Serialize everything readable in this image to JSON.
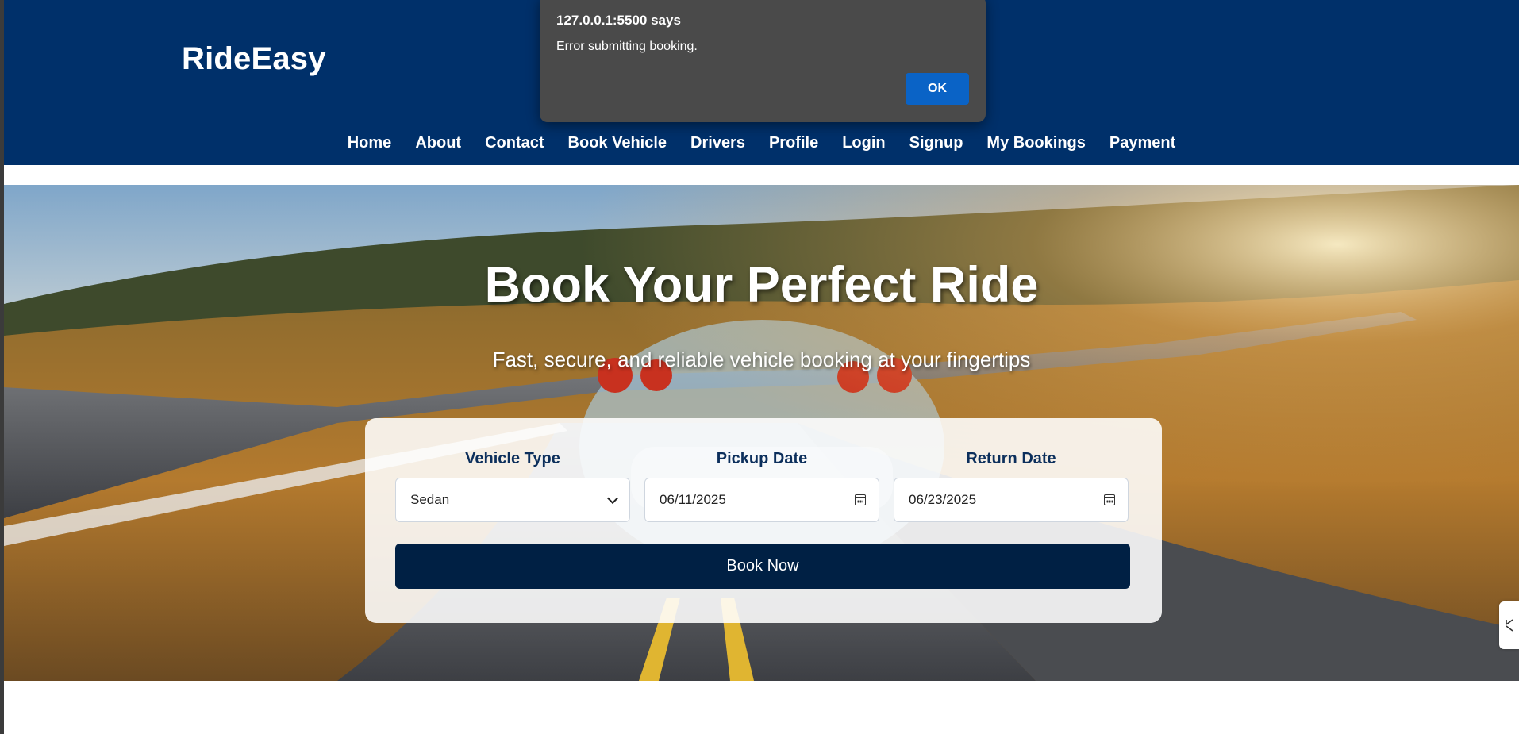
{
  "brand": {
    "name": "RideEasy"
  },
  "nav": {
    "items": [
      {
        "label": "Home"
      },
      {
        "label": "About"
      },
      {
        "label": "Contact"
      },
      {
        "label": "Book Vehicle"
      },
      {
        "label": "Drivers"
      },
      {
        "label": "Profile"
      },
      {
        "label": "Login"
      },
      {
        "label": "Signup"
      },
      {
        "label": "My Bookings"
      },
      {
        "label": "Payment"
      }
    ]
  },
  "hero": {
    "title": "Book Your Perfect Ride",
    "subtitle": "Fast, secure, and reliable vehicle booking at your fingertips"
  },
  "booking": {
    "vehicle_label": "Vehicle Type",
    "vehicle_value": "Sedan",
    "pickup_label": "Pickup Date",
    "pickup_value": "06/11/2025",
    "return_label": "Return Date",
    "return_value": "06/23/2025",
    "submit_label": "Book Now"
  },
  "dialog": {
    "title": "127.0.0.1:5500 says",
    "message": "Error submitting booking.",
    "ok_label": "OK"
  },
  "colors": {
    "header_bg": "#00306a",
    "button_bg": "#002044",
    "dialog_bg": "#4a4a4a",
    "ok_bg": "#0a63c6",
    "label_text": "#0c2f5c"
  },
  "icons": {
    "select": "chevron-down-icon",
    "date": "calendar-icon",
    "side_tab": "expand-icon"
  }
}
